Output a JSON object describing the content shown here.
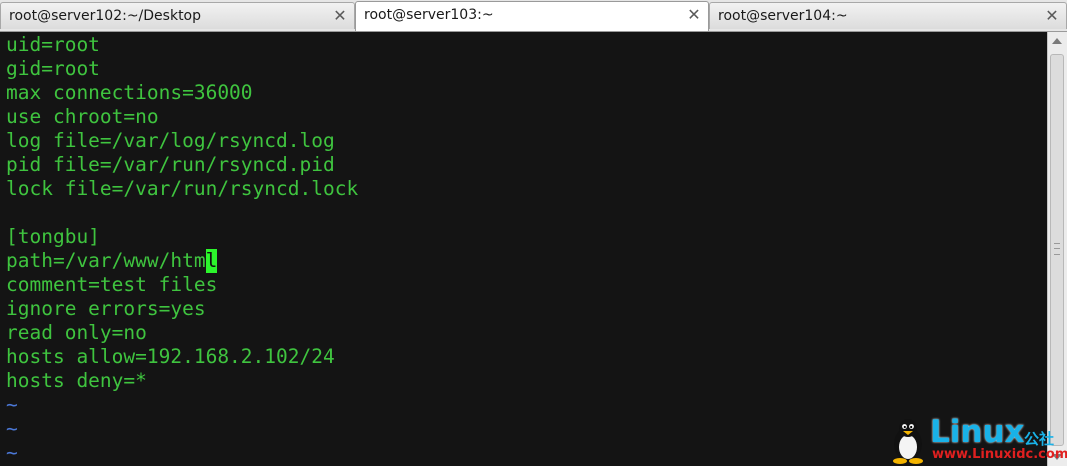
{
  "tabs": [
    {
      "label": "root@server102:~/Desktop",
      "close": "✕",
      "active": false
    },
    {
      "label": "root@server103:~",
      "close": "✕",
      "active": true
    },
    {
      "label": "root@server104:~",
      "close": "✕",
      "active": false
    }
  ],
  "terminal": {
    "lines": [
      "uid=root",
      "gid=root",
      "max connections=36000",
      "use chroot=no",
      "log file=/var/log/rsyncd.log",
      "pid file=/var/run/rsyncd.pid",
      "lock file=/var/run/rsyncd.lock",
      "",
      "[tongbu]",
      "path=/var/www/htm",
      "comment=test files",
      "ignore errors=yes",
      "read only=no",
      "hosts allow=192.168.2.102/24",
      "hosts deny=*",
      "~",
      "~",
      "~"
    ],
    "cursor_char": "l",
    "text_color": "#3fc43f",
    "cursor_color": "#2cf52c",
    "background": "#141414"
  },
  "watermark": {
    "brand": "Linux",
    "suffix": "公社",
    "url": "www.Linuxidc.com",
    "icon": "penguin-icon"
  }
}
